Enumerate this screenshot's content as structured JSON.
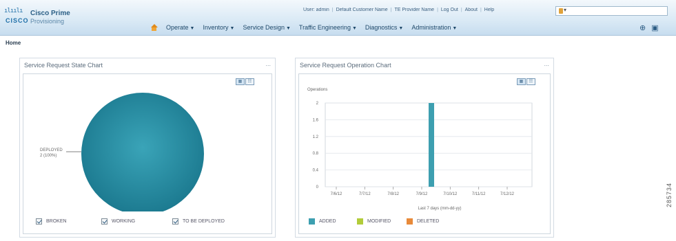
{
  "header": {
    "logo_bars": "ılıılı",
    "logo_company": "CISCO",
    "product_name": "Cisco Prime",
    "product_sub": "Provisioning",
    "top_links": [
      "User: admin",
      "Default Customer Name",
      "TE Provider Name",
      "Log Out",
      "About",
      "Help"
    ],
    "search_icon": "lightbulb-icon",
    "search_dropdown": "▾",
    "nav": [
      {
        "label": "Operate"
      },
      {
        "label": "Inventory"
      },
      {
        "label": "Service Design"
      },
      {
        "label": "Traffic Engineering"
      },
      {
        "label": "Diagnostics"
      },
      {
        "label": "Administration"
      }
    ],
    "right_icons": [
      "help-icon",
      "info-icon"
    ]
  },
  "breadcrumb": "Home",
  "left_portlet": {
    "title": "Service Request State Chart",
    "menu": "...",
    "toggle_chart": "▦",
    "toggle_table": "☷",
    "pie_label_line1": "DEPLOYED",
    "pie_label_line2": "2 (100%)",
    "legend": [
      {
        "label": "BROKEN",
        "checked": true
      },
      {
        "label": "WORKING",
        "checked": true
      },
      {
        "label": "TO BE DEPLOYED",
        "checked": true
      }
    ]
  },
  "right_portlet": {
    "title": "Service Request Operation Chart",
    "menu": "...",
    "toggle_chart": "▦",
    "toggle_table": "☷",
    "y_title": "Operations",
    "x_title": "Last 7 days (mm-dd-yy)",
    "legend": [
      {
        "label": "ADDED",
        "color": "#3d9fb0"
      },
      {
        "label": "MODIFIED",
        "color": "#b2cc3a"
      },
      {
        "label": "DELETED",
        "color": "#e88a3a"
      }
    ]
  },
  "figure_id": "285734",
  "chart_data": [
    {
      "type": "pie",
      "title": "Service Request State Chart",
      "slices": [
        {
          "label": "DEPLOYED",
          "value": 2,
          "percent": 100
        }
      ],
      "legend": [
        "BROKEN",
        "WORKING",
        "TO BE DEPLOYED"
      ],
      "colors": {
        "DEPLOYED": "#2a8da3"
      }
    },
    {
      "type": "bar",
      "title": "Service Request Operation Chart",
      "ylabel": "Operations",
      "xlabel": "Last 7 days (mm-dd-yy)",
      "categories": [
        "7/6/12",
        "7/7/12",
        "7/8/12",
        "7/9/12",
        "7/10/12",
        "7/11/12",
        "7/12/12"
      ],
      "series": [
        {
          "name": "ADDED",
          "values": [
            0,
            0,
            0,
            2,
            0,
            0,
            0
          ],
          "color": "#3d9fb0"
        },
        {
          "name": "MODIFIED",
          "values": [
            0,
            0,
            0,
            0,
            0,
            0,
            0
          ],
          "color": "#b2cc3a"
        },
        {
          "name": "DELETED",
          "values": [
            0,
            0,
            0,
            0,
            0,
            0,
            0
          ],
          "color": "#e88a3a"
        }
      ],
      "yticks": [
        "0",
        "0.4",
        "0.8",
        "1.2",
        "1.6",
        "2"
      ],
      "ylim": [
        0,
        2
      ],
      "grid": true
    }
  ]
}
